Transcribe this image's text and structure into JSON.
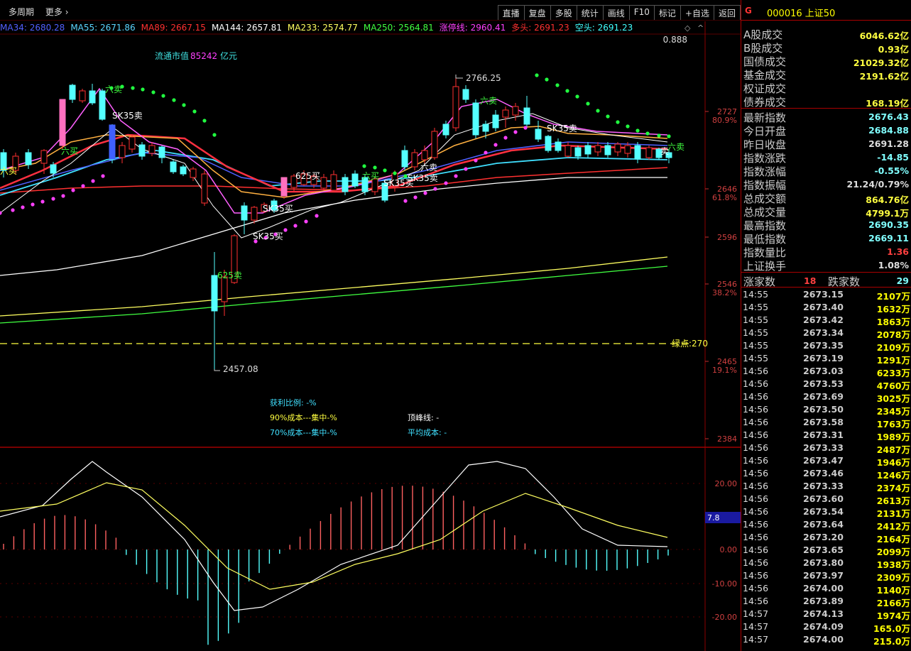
{
  "toolbar": {
    "period": "多周期",
    "more": "更多",
    "buttons": [
      "直播",
      "复盘",
      "多股",
      "统计",
      "画线",
      "F10",
      "标记",
      "+自选",
      "返回"
    ]
  },
  "ma_legend": [
    {
      "text": "MA34: 2680.28",
      "color": "#5060ff"
    },
    {
      "text": "MA55: 2671.86",
      "color": "#5ad5ff"
    },
    {
      "text": "MA89: 2667.15",
      "color": "#ff3030"
    },
    {
      "text": "MA144: 2657.81",
      "color": "#ffffff"
    },
    {
      "text": "MA233: 2574.77",
      "color": "#ffff60"
    },
    {
      "text": "MA250: 2564.81",
      "color": "#40ff40"
    },
    {
      "text": "涨停线: 2960.41",
      "color": "#ff40ff"
    },
    {
      "text": "多头: 2691.23",
      "color": "#ff3030"
    },
    {
      "text": "空头: 2691.23",
      "color": "#40ffff"
    }
  ],
  "chart": {
    "market_cap_label": "流通市值",
    "market_cap_value": "85242",
    "market_cap_unit": "亿元",
    "corner_value": "0.888",
    "high_label": "2766.25",
    "low_label": "2457.08",
    "green_point": "绿点:270",
    "price_axis": [
      {
        "v": "2727",
        "pct": "80.9%"
      },
      {
        "v": "2646",
        "pct": "61.8%"
      },
      {
        "v": "2596",
        "pct": ""
      },
      {
        "v": "2546",
        "pct": "38.2%"
      },
      {
        "v": "2465",
        "pct": "19.1%"
      },
      {
        "v": "2384",
        "pct": ""
      }
    ],
    "macd_axis": [
      "20.00",
      "0.00",
      "-10.00",
      "-20.00"
    ],
    "macd_marker": "7.8",
    "signals": [
      "六卖",
      "SK35卖",
      "六买",
      "625买",
      "SK35买",
      "六买",
      "625卖",
      "SK35买",
      "六卖",
      "SK35卖",
      "六卖",
      "卖",
      "SK35买",
      "六买",
      "SK35卖",
      "六卖"
    ],
    "chip_info": {
      "profit": "获利比例: -%",
      "c90": "90%成本---集中-%",
      "c70": "70%成本---集中-%",
      "peak": "顶峰线: -",
      "avg": "平均成本: -"
    }
  },
  "right_panel": {
    "letter": "G",
    "code": "000016 上证50",
    "stats_top": [
      {
        "k": "A股成交",
        "v": "6046.62亿",
        "c": "#ffff40"
      },
      {
        "k": "B股成交",
        "v": "0.93亿",
        "c": "#ffff40"
      },
      {
        "k": "国债成交",
        "v": "21029.32亿",
        "c": "#ffff40"
      },
      {
        "k": "基金成交",
        "v": "2191.62亿",
        "c": "#ffff40"
      },
      {
        "k": "权证成交",
        "v": "",
        "c": "#ffff40"
      },
      {
        "k": "债券成交",
        "v": "168.19亿",
        "c": "#ffff40"
      }
    ],
    "stats_mid": [
      {
        "k": "最新指数",
        "v": "2676.43",
        "c": "#80ffff"
      },
      {
        "k": "今日开盘",
        "v": "2684.88",
        "c": "#80ffff"
      },
      {
        "k": "昨日收盘",
        "v": "2691.28",
        "c": "#dddddd"
      },
      {
        "k": "指数涨跌",
        "v": "-14.85",
        "c": "#80ffff"
      },
      {
        "k": "指数涨幅",
        "v": "-0.55%",
        "c": "#80ffff"
      },
      {
        "k": "指数振幅",
        "v": "21.24/0.79%",
        "c": "#dddddd"
      },
      {
        "k": "总成交额",
        "v": "864.76亿",
        "c": "#ffff40"
      },
      {
        "k": "总成交量",
        "v": "4799.1万",
        "c": "#ffff40"
      },
      {
        "k": "最高指数",
        "v": "2690.35",
        "c": "#80ffff"
      },
      {
        "k": "最低指数",
        "v": "2669.11",
        "c": "#80ffff"
      },
      {
        "k": "指数量比",
        "v": "1.36",
        "c": "#ff4040"
      },
      {
        "k": "上证换手",
        "v": "1.08%",
        "c": "#dddddd"
      }
    ],
    "updown": {
      "up_label": "涨家数",
      "up_value": "18",
      "down_label": "跌家数",
      "down_value": "29"
    },
    "ticks": [
      [
        "14:55",
        "2673.15",
        "2107万"
      ],
      [
        "14:55",
        "2673.40",
        "1632万"
      ],
      [
        "14:55",
        "2673.42",
        "1863万"
      ],
      [
        "14:55",
        "2673.34",
        "2078万"
      ],
      [
        "14:55",
        "2673.35",
        "2109万"
      ],
      [
        "14:55",
        "2673.19",
        "1291万"
      ],
      [
        "14:56",
        "2673.03",
        "6233万"
      ],
      [
        "14:56",
        "2673.53",
        "4760万"
      ],
      [
        "14:56",
        "2673.69",
        "3025万"
      ],
      [
        "14:56",
        "2673.50",
        "2345万"
      ],
      [
        "14:56",
        "2673.58",
        "1763万"
      ],
      [
        "14:56",
        "2673.31",
        "1989万"
      ],
      [
        "14:56",
        "2673.33",
        "2487万"
      ],
      [
        "14:56",
        "2673.47",
        "1946万"
      ],
      [
        "14:56",
        "2673.46",
        "1246万"
      ],
      [
        "14:56",
        "2673.33",
        "2374万"
      ],
      [
        "14:56",
        "2673.60",
        "2613万"
      ],
      [
        "14:56",
        "2673.54",
        "2131万"
      ],
      [
        "14:56",
        "2673.64",
        "2412万"
      ],
      [
        "14:56",
        "2673.20",
        "2164万"
      ],
      [
        "14:56",
        "2673.65",
        "2099万"
      ],
      [
        "14:56",
        "2673.80",
        "1938万"
      ],
      [
        "14:56",
        "2673.97",
        "2309万"
      ],
      [
        "14:56",
        "2674.00",
        "1140万"
      ],
      [
        "14:56",
        "2673.89",
        "2166万"
      ],
      [
        "14:57",
        "2674.13",
        "1974万"
      ],
      [
        "14:57",
        "2674.09",
        "165.0万"
      ],
      [
        "14:57",
        "2674.00",
        "215.0万"
      ]
    ]
  },
  "colors": {
    "up": "#ff3030",
    "down": "#54ffff",
    "bg": "#000000",
    "grid": "#8b0000"
  }
}
